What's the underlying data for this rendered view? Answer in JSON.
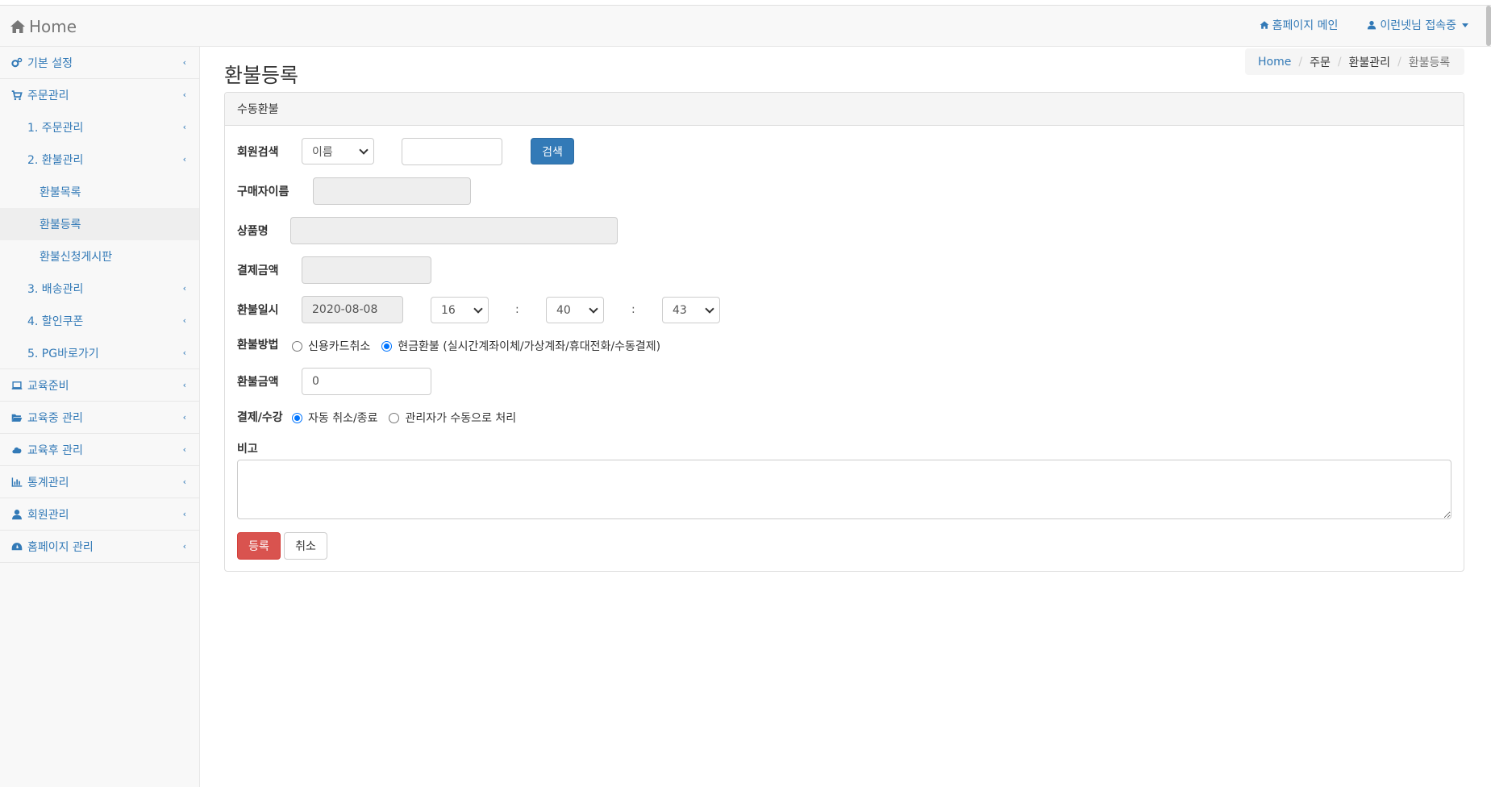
{
  "navbar": {
    "brand": "Home",
    "homepage_link": "홈페이지 메인",
    "user_status": "이런넷님 접속중"
  },
  "sidebar": {
    "items": [
      {
        "label": "기본 설정",
        "icon": "gears-icon"
      },
      {
        "label": "주문관리",
        "icon": "cart-icon"
      },
      {
        "label": "1. 주문관리"
      },
      {
        "label": "2. 환불관리"
      },
      {
        "label": "환불목록"
      },
      {
        "label": "환불등록"
      },
      {
        "label": "환불신청게시판"
      },
      {
        "label": "3. 배송관리"
      },
      {
        "label": "4. 할인쿠폰"
      },
      {
        "label": "5. PG바로가기"
      },
      {
        "label": "교육준비",
        "icon": "laptop-icon"
      },
      {
        "label": "교육중 관리",
        "icon": "folder-open-icon"
      },
      {
        "label": "교육후 관리",
        "icon": "cloud-upload-icon"
      },
      {
        "label": "통계관리",
        "icon": "bar-chart-icon"
      },
      {
        "label": "회원관리",
        "icon": "user-icon"
      },
      {
        "label": "홈페이지 관리",
        "icon": "dashboard-icon"
      }
    ],
    "chevron": "‹"
  },
  "page": {
    "title": "환불등록"
  },
  "breadcrumb": [
    "Home",
    "주문",
    "환불관리",
    "환불등록"
  ],
  "panel": {
    "heading": "수동환불"
  },
  "form": {
    "member_search_label": "회원검색",
    "member_search_select": "이름",
    "member_search_value": "",
    "search_button": "검색",
    "buyer_name_label": "구매자이름",
    "product_label": "상품명",
    "payment_amount_label": "결제금액",
    "refund_datetime_label": "환불일시",
    "refund_date": "2020-08-08",
    "hour": "16",
    "minute": "40",
    "second": "43",
    "colon": ":",
    "refund_method_label": "환불방법",
    "refund_method_options": [
      "신용카드취소",
      "현금환불 (실시간계좌이체/가상계좌/휴대전화/수동결제)"
    ],
    "refund_amount_label": "환불금액",
    "refund_amount": "0",
    "payment_course_label": "결제/수강",
    "payment_course_options": [
      "자동 취소/종료",
      "관리자가 수동으로 처리"
    ],
    "note_label": "비고",
    "submit_button": "등록",
    "cancel_button": "취소"
  },
  "colors": {
    "primary": "#337ab7",
    "danger": "#d9534f",
    "radio_checked": "#0075ff"
  }
}
